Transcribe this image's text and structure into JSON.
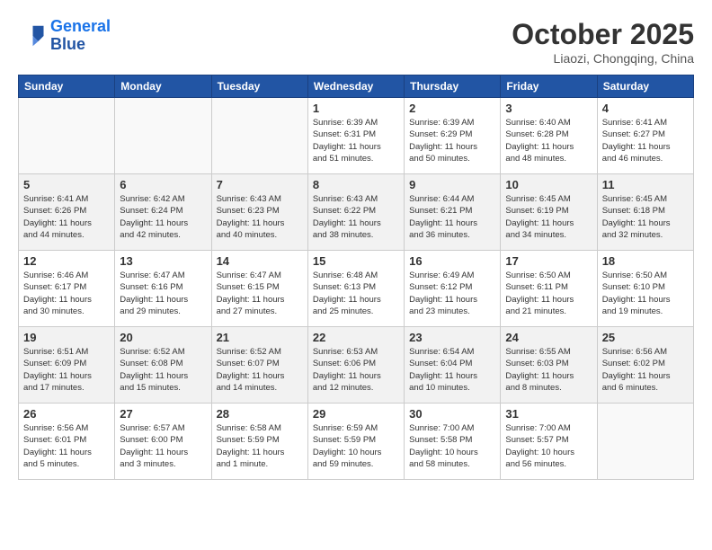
{
  "header": {
    "logo_line1": "General",
    "logo_line2": "Blue",
    "month": "October 2025",
    "location": "Liaozi, Chongqing, China"
  },
  "weekdays": [
    "Sunday",
    "Monday",
    "Tuesday",
    "Wednesday",
    "Thursday",
    "Friday",
    "Saturday"
  ],
  "weeks": [
    [
      {
        "day": "",
        "info": ""
      },
      {
        "day": "",
        "info": ""
      },
      {
        "day": "",
        "info": ""
      },
      {
        "day": "1",
        "info": "Sunrise: 6:39 AM\nSunset: 6:31 PM\nDaylight: 11 hours\nand 51 minutes."
      },
      {
        "day": "2",
        "info": "Sunrise: 6:39 AM\nSunset: 6:29 PM\nDaylight: 11 hours\nand 50 minutes."
      },
      {
        "day": "3",
        "info": "Sunrise: 6:40 AM\nSunset: 6:28 PM\nDaylight: 11 hours\nand 48 minutes."
      },
      {
        "day": "4",
        "info": "Sunrise: 6:41 AM\nSunset: 6:27 PM\nDaylight: 11 hours\nand 46 minutes."
      }
    ],
    [
      {
        "day": "5",
        "info": "Sunrise: 6:41 AM\nSunset: 6:26 PM\nDaylight: 11 hours\nand 44 minutes."
      },
      {
        "day": "6",
        "info": "Sunrise: 6:42 AM\nSunset: 6:24 PM\nDaylight: 11 hours\nand 42 minutes."
      },
      {
        "day": "7",
        "info": "Sunrise: 6:43 AM\nSunset: 6:23 PM\nDaylight: 11 hours\nand 40 minutes."
      },
      {
        "day": "8",
        "info": "Sunrise: 6:43 AM\nSunset: 6:22 PM\nDaylight: 11 hours\nand 38 minutes."
      },
      {
        "day": "9",
        "info": "Sunrise: 6:44 AM\nSunset: 6:21 PM\nDaylight: 11 hours\nand 36 minutes."
      },
      {
        "day": "10",
        "info": "Sunrise: 6:45 AM\nSunset: 6:19 PM\nDaylight: 11 hours\nand 34 minutes."
      },
      {
        "day": "11",
        "info": "Sunrise: 6:45 AM\nSunset: 6:18 PM\nDaylight: 11 hours\nand 32 minutes."
      }
    ],
    [
      {
        "day": "12",
        "info": "Sunrise: 6:46 AM\nSunset: 6:17 PM\nDaylight: 11 hours\nand 30 minutes."
      },
      {
        "day": "13",
        "info": "Sunrise: 6:47 AM\nSunset: 6:16 PM\nDaylight: 11 hours\nand 29 minutes."
      },
      {
        "day": "14",
        "info": "Sunrise: 6:47 AM\nSunset: 6:15 PM\nDaylight: 11 hours\nand 27 minutes."
      },
      {
        "day": "15",
        "info": "Sunrise: 6:48 AM\nSunset: 6:13 PM\nDaylight: 11 hours\nand 25 minutes."
      },
      {
        "day": "16",
        "info": "Sunrise: 6:49 AM\nSunset: 6:12 PM\nDaylight: 11 hours\nand 23 minutes."
      },
      {
        "day": "17",
        "info": "Sunrise: 6:50 AM\nSunset: 6:11 PM\nDaylight: 11 hours\nand 21 minutes."
      },
      {
        "day": "18",
        "info": "Sunrise: 6:50 AM\nSunset: 6:10 PM\nDaylight: 11 hours\nand 19 minutes."
      }
    ],
    [
      {
        "day": "19",
        "info": "Sunrise: 6:51 AM\nSunset: 6:09 PM\nDaylight: 11 hours\nand 17 minutes."
      },
      {
        "day": "20",
        "info": "Sunrise: 6:52 AM\nSunset: 6:08 PM\nDaylight: 11 hours\nand 15 minutes."
      },
      {
        "day": "21",
        "info": "Sunrise: 6:52 AM\nSunset: 6:07 PM\nDaylight: 11 hours\nand 14 minutes."
      },
      {
        "day": "22",
        "info": "Sunrise: 6:53 AM\nSunset: 6:06 PM\nDaylight: 11 hours\nand 12 minutes."
      },
      {
        "day": "23",
        "info": "Sunrise: 6:54 AM\nSunset: 6:04 PM\nDaylight: 11 hours\nand 10 minutes."
      },
      {
        "day": "24",
        "info": "Sunrise: 6:55 AM\nSunset: 6:03 PM\nDaylight: 11 hours\nand 8 minutes."
      },
      {
        "day": "25",
        "info": "Sunrise: 6:56 AM\nSunset: 6:02 PM\nDaylight: 11 hours\nand 6 minutes."
      }
    ],
    [
      {
        "day": "26",
        "info": "Sunrise: 6:56 AM\nSunset: 6:01 PM\nDaylight: 11 hours\nand 5 minutes."
      },
      {
        "day": "27",
        "info": "Sunrise: 6:57 AM\nSunset: 6:00 PM\nDaylight: 11 hours\nand 3 minutes."
      },
      {
        "day": "28",
        "info": "Sunrise: 6:58 AM\nSunset: 5:59 PM\nDaylight: 11 hours\nand 1 minute."
      },
      {
        "day": "29",
        "info": "Sunrise: 6:59 AM\nSunset: 5:59 PM\nDaylight: 10 hours\nand 59 minutes."
      },
      {
        "day": "30",
        "info": "Sunrise: 7:00 AM\nSunset: 5:58 PM\nDaylight: 10 hours\nand 58 minutes."
      },
      {
        "day": "31",
        "info": "Sunrise: 7:00 AM\nSunset: 5:57 PM\nDaylight: 10 hours\nand 56 minutes."
      },
      {
        "day": "",
        "info": ""
      }
    ]
  ]
}
